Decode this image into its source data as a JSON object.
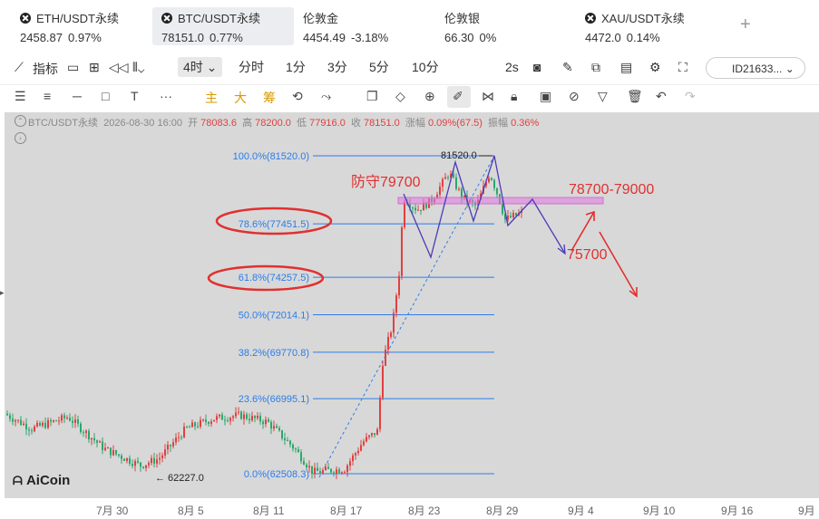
{
  "tickers": [
    {
      "name": "ETH/USDT永续",
      "price": "2458.87",
      "change": "0.97%",
      "icon": true
    },
    {
      "name": "BTC/USDT永续",
      "price": "78151.0",
      "change": "0.77%",
      "icon": true,
      "active": true
    },
    {
      "name": "伦敦金",
      "price": "4454.49",
      "change": "-3.18%",
      "icon": false
    },
    {
      "name": "伦敦银",
      "price": "66.30",
      "change": "0%",
      "icon": false
    },
    {
      "name": "XAU/USDT永续",
      "price": "4472.0",
      "change": "0.14%",
      "icon": true
    }
  ],
  "toolbar1": {
    "indicators": "指标",
    "timeframe_selected": "4时",
    "timeframes": [
      "分时",
      "1分",
      "3分",
      "5分",
      "10分"
    ],
    "interval": "2s",
    "id_label": "ID21633..."
  },
  "toolbar2": {
    "main": "主",
    "big": "大",
    "chip": "筹"
  },
  "info": {
    "symbol": "BTC/USDT永续",
    "datetime": "2026-08-30 16:00",
    "open_label": "开",
    "open": "78083.6",
    "high_label": "高",
    "high": "78200.0",
    "low_label": "低",
    "low": "77916.0",
    "close_label": "收",
    "close": "78151.0",
    "chg_label": "涨幅",
    "chg": "0.09%(67.5)",
    "amp_label": "振幅",
    "amp": "0.36%"
  },
  "fib": [
    {
      "label": "100.0%(81520.0)",
      "price": 81520.0
    },
    {
      "label": "78.6%(77451.5)",
      "price": 77451.5
    },
    {
      "label": "61.8%(74257.5)",
      "price": 74257.5
    },
    {
      "label": "50.0%(72014.1)",
      "price": 72014.1
    },
    {
      "label": "38.2%(69770.8)",
      "price": 69770.8
    },
    {
      "label": "23.6%(66995.1)",
      "price": 66995.1
    },
    {
      "label": "0.0%(62508.3)",
      "price": 62508.3
    }
  ],
  "annotations": {
    "high_mark": "81520.0",
    "low_mark": "62227.0",
    "defend": "防守79700",
    "zone": "78700-79000",
    "target": "75700"
  },
  "xaxis": [
    "7月 30",
    "8月 5",
    "8月 11",
    "8月 17",
    "8月 23",
    "8月 29",
    "9月 4",
    "9月 10",
    "9月 16",
    "9月"
  ],
  "logo": "AiCoin",
  "colors": {
    "up": "#e04040",
    "down": "#2aa86b",
    "fib": "#2b7de9",
    "annot": "#e03030",
    "path": "#4b3bb8",
    "zone": "#d070d0"
  }
}
